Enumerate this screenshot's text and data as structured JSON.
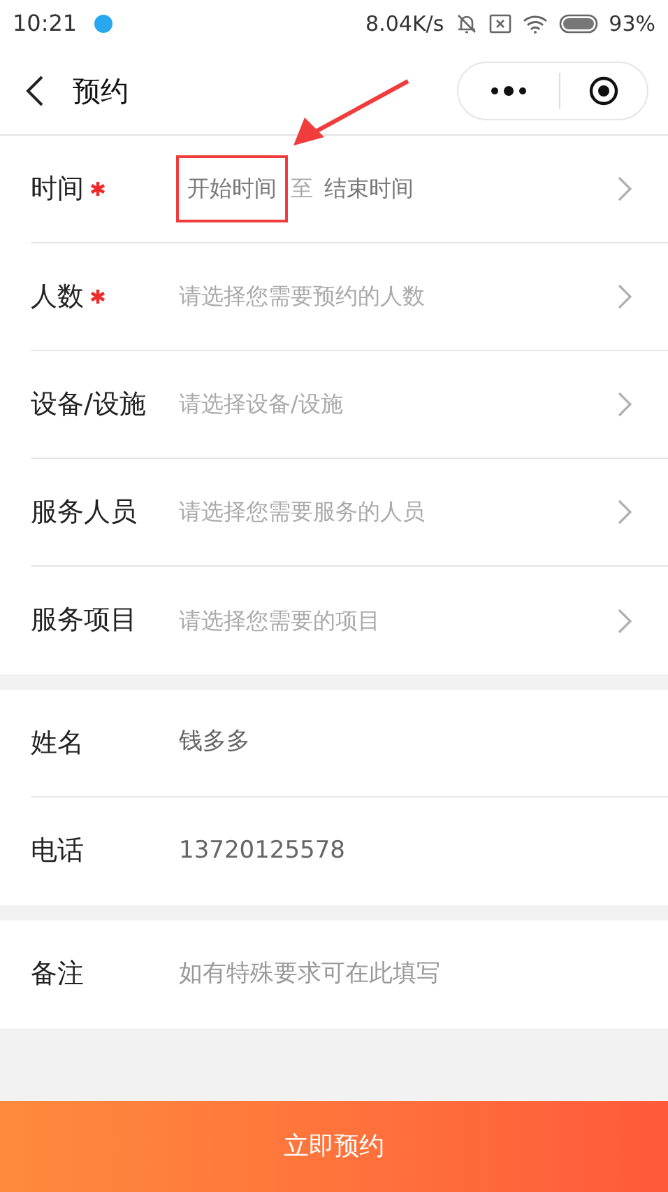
{
  "status_bar": {
    "time": "10:21",
    "network_speed": "8.04K/s",
    "battery": "93%"
  },
  "header": {
    "title": "预约"
  },
  "sections": [
    {
      "rows": [
        {
          "kind": "range",
          "label": "时间",
          "required": true,
          "start_placeholder": "开始时间",
          "separator": "至",
          "end_placeholder": "结束时间",
          "highlighted": true
        },
        {
          "kind": "select",
          "label": "人数",
          "required": true,
          "placeholder": "请选择您需要预约的人数"
        },
        {
          "kind": "select",
          "label": "设备/设施",
          "required": false,
          "placeholder": "请选择设备/设施"
        },
        {
          "kind": "select",
          "label": "服务人员",
          "required": false,
          "placeholder": "请选择您需要服务的人员"
        },
        {
          "kind": "select",
          "label": "服务项目",
          "required": false,
          "placeholder": "请选择您需要的项目"
        }
      ]
    },
    {
      "rows": [
        {
          "kind": "input",
          "label": "姓名",
          "value": "钱多多"
        },
        {
          "kind": "input",
          "label": "电话",
          "value": "13720125578"
        }
      ]
    },
    {
      "rows": [
        {
          "kind": "input",
          "label": "备注",
          "placeholder": "如有特殊要求可在此填写"
        }
      ]
    }
  ],
  "submit_button": "立即预约"
}
